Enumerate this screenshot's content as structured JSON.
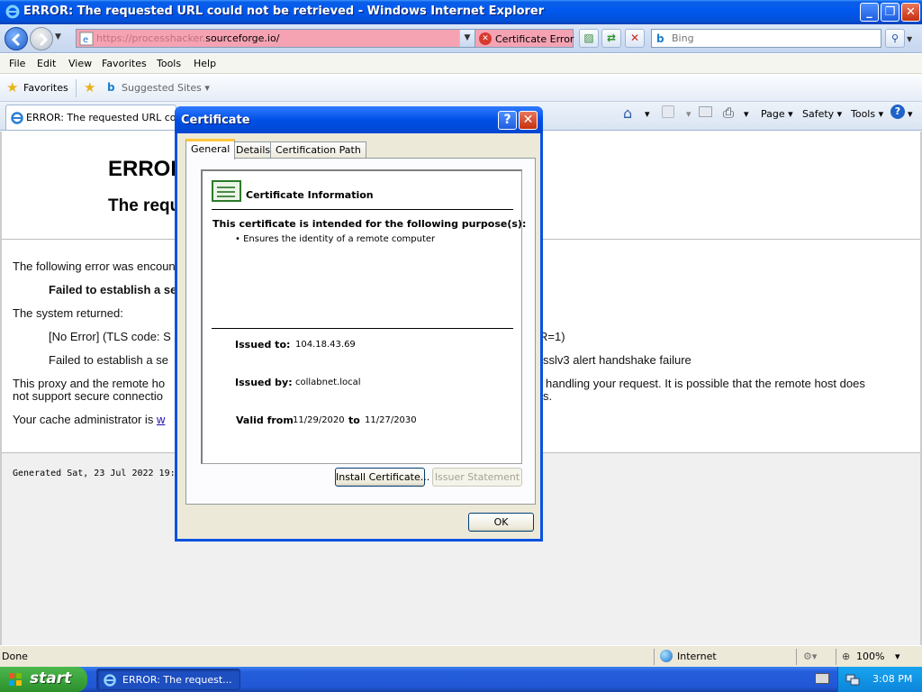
{
  "window": {
    "title": "ERROR: The requested URL could not be retrieved - Windows Internet Explorer",
    "minimize": "_",
    "restore": "❐",
    "close": "✕"
  },
  "addressbar": {
    "url_faded": "https://processhacker.",
    "url_domain": "sourceforge.io/",
    "cert_error_label": "Certificate Error",
    "search_placeholder": "Bing",
    "nav_dropdown": "▼",
    "url_dropdown": "▼",
    "search_dropdown": "▼",
    "error_color": "#f5a3b3"
  },
  "menu": {
    "items": [
      "File",
      "Edit",
      "View",
      "Favorites",
      "Tools",
      "Help"
    ]
  },
  "favorites": {
    "label": "Favorites",
    "suggested": "Suggested Sites ▾"
  },
  "tab": {
    "title": "ERROR: The requested URL could not be retrieved"
  },
  "commandbar": {
    "page": "Page ▾",
    "safety": "Safety ▾",
    "tools": "Tools ▾",
    "home_dd": "▾",
    "print_dd": "▾",
    "help_dd": "▾"
  },
  "page": {
    "heading1": "ERROR",
    "heading2": "The requested URL could not be retrieved",
    "line1": "The following error was encountered while trying to retrieve the URL:",
    "line2": "Failed to establish a secure connection to",
    "line3": "The system returned:",
    "line4_left": "[No Error] (TLS code: S",
    "line4_right": "R=1)",
    "line5_left": "Failed to establish a se",
    "line5_right": "sslv3 alert handshake failure",
    "line6_left": "This proxy and the remote ho",
    "line6_right": "handling your request. It is possible that the remote host does",
    "line7_left": "not support secure connectio",
    "line7_right": "s.",
    "line8_left": "Your cache administrator is",
    "line8_link": "w",
    "generated": "Generated Sat, 23 Jul 2022 19:07:4"
  },
  "status": {
    "left": "Done",
    "zone": "Internet",
    "zoom": "100%",
    "zoom_dd": "▾"
  },
  "taskbar": {
    "start": "start",
    "item": "ERROR: The request...",
    "clock": "3:08 PM"
  },
  "dialog": {
    "title": "Certificate",
    "help": "?",
    "close": "✕",
    "tabs": [
      "General",
      "Details",
      "Certification Path"
    ],
    "info_title": "Certificate Information",
    "purpose_heading": "This certificate is intended for the following purpose(s):",
    "purpose_item": "• Ensures the identity of a remote computer",
    "issued_to_label": "Issued to:",
    "issued_to_value": "104.18.43.69",
    "issued_by_label": "Issued by:",
    "issued_by_value": "collabnet.local",
    "valid_from_label": "Valid from",
    "valid_from_value": "11/29/2020",
    "to_label": "to",
    "valid_to_value": "11/27/2030",
    "install_button": "Install Certificate...",
    "issuer_button": "Issuer Statement",
    "ok_button": "OK"
  }
}
